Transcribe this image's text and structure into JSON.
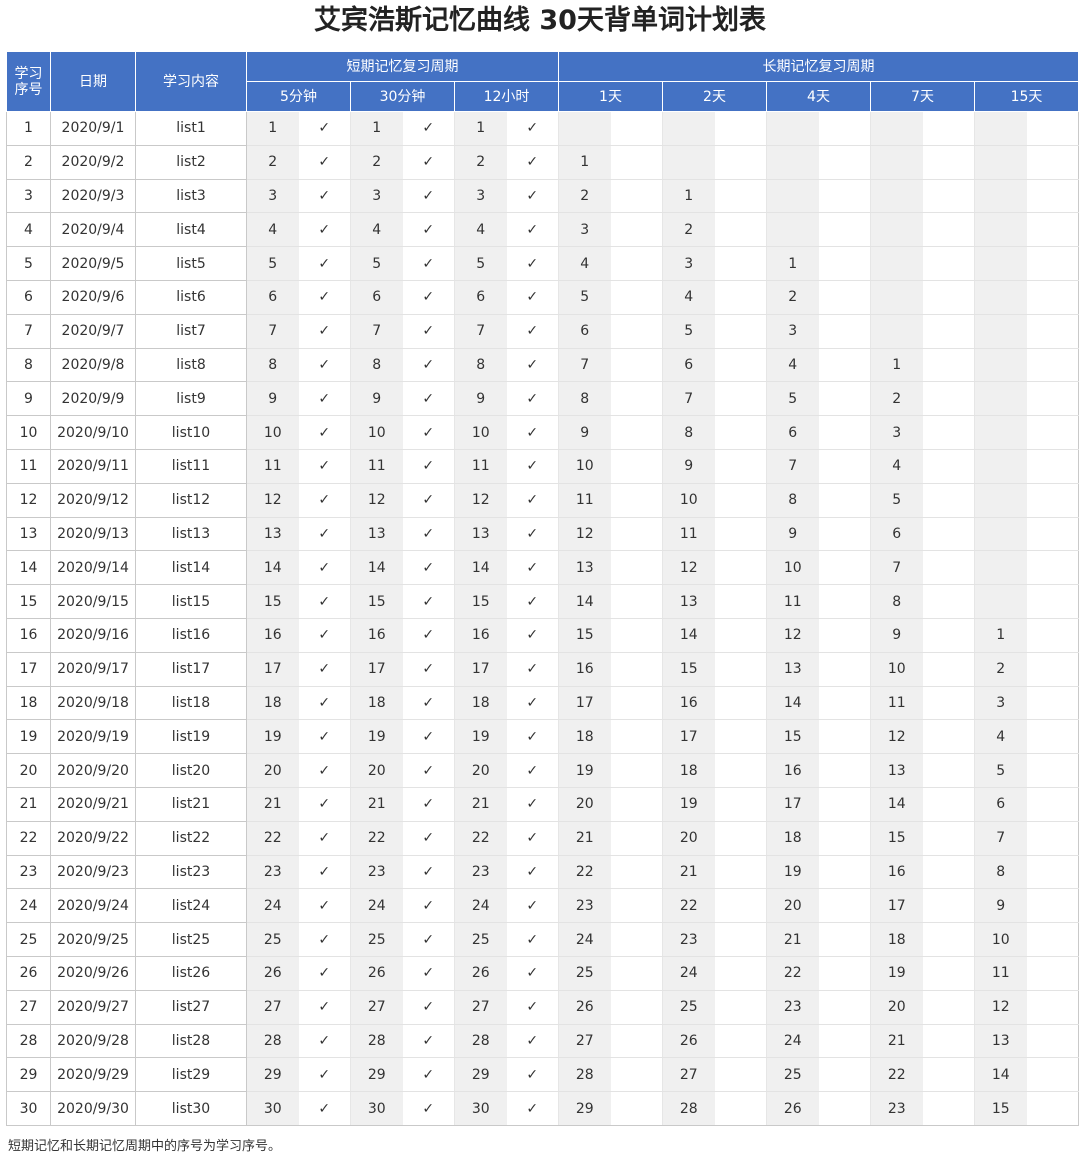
{
  "title": "艾宾浩斯记忆曲线 30天背单词计划表",
  "header": {
    "seq": "学习\n序号",
    "date": "日期",
    "content": "学习内容",
    "short_group": "短期记忆复习周期",
    "long_group": "长期记忆复习周期",
    "short_periods": [
      "5分钟",
      "30分钟",
      "12小时"
    ],
    "long_periods": [
      "1天",
      "2天",
      "4天",
      "7天",
      "15天"
    ]
  },
  "check_mark": "✓",
  "colors": {
    "header_bg": "#4472c4",
    "shaded_cell": "#f0f0f0"
  },
  "rows": [
    {
      "seq": "1",
      "date": "2020/9/1",
      "content": "list1",
      "long": [
        "",
        "",
        "",
        "",
        ""
      ]
    },
    {
      "seq": "2",
      "date": "2020/9/2",
      "content": "list2",
      "long": [
        "1",
        "",
        "",
        "",
        ""
      ]
    },
    {
      "seq": "3",
      "date": "2020/9/3",
      "content": "list3",
      "long": [
        "2",
        "1",
        "",
        "",
        ""
      ]
    },
    {
      "seq": "4",
      "date": "2020/9/4",
      "content": "list4",
      "long": [
        "3",
        "2",
        "",
        "",
        ""
      ]
    },
    {
      "seq": "5",
      "date": "2020/9/5",
      "content": "list5",
      "long": [
        "4",
        "3",
        "1",
        "",
        ""
      ]
    },
    {
      "seq": "6",
      "date": "2020/9/6",
      "content": "list6",
      "long": [
        "5",
        "4",
        "2",
        "",
        ""
      ]
    },
    {
      "seq": "7",
      "date": "2020/9/7",
      "content": "list7",
      "long": [
        "6",
        "5",
        "3",
        "",
        ""
      ]
    },
    {
      "seq": "8",
      "date": "2020/9/8",
      "content": "list8",
      "long": [
        "7",
        "6",
        "4",
        "1",
        ""
      ]
    },
    {
      "seq": "9",
      "date": "2020/9/9",
      "content": "list9",
      "long": [
        "8",
        "7",
        "5",
        "2",
        ""
      ]
    },
    {
      "seq": "10",
      "date": "2020/9/10",
      "content": "list10",
      "long": [
        "9",
        "8",
        "6",
        "3",
        ""
      ]
    },
    {
      "seq": "11",
      "date": "2020/9/11",
      "content": "list11",
      "long": [
        "10",
        "9",
        "7",
        "4",
        ""
      ]
    },
    {
      "seq": "12",
      "date": "2020/9/12",
      "content": "list12",
      "long": [
        "11",
        "10",
        "8",
        "5",
        ""
      ]
    },
    {
      "seq": "13",
      "date": "2020/9/13",
      "content": "list13",
      "long": [
        "12",
        "11",
        "9",
        "6",
        ""
      ]
    },
    {
      "seq": "14",
      "date": "2020/9/14",
      "content": "list14",
      "long": [
        "13",
        "12",
        "10",
        "7",
        ""
      ]
    },
    {
      "seq": "15",
      "date": "2020/9/15",
      "content": "list15",
      "long": [
        "14",
        "13",
        "11",
        "8",
        ""
      ]
    },
    {
      "seq": "16",
      "date": "2020/9/16",
      "content": "list16",
      "long": [
        "15",
        "14",
        "12",
        "9",
        "1"
      ]
    },
    {
      "seq": "17",
      "date": "2020/9/17",
      "content": "list17",
      "long": [
        "16",
        "15",
        "13",
        "10",
        "2"
      ]
    },
    {
      "seq": "18",
      "date": "2020/9/18",
      "content": "list18",
      "long": [
        "17",
        "16",
        "14",
        "11",
        "3"
      ]
    },
    {
      "seq": "19",
      "date": "2020/9/19",
      "content": "list19",
      "long": [
        "18",
        "17",
        "15",
        "12",
        "4"
      ]
    },
    {
      "seq": "20",
      "date": "2020/9/20",
      "content": "list20",
      "long": [
        "19",
        "18",
        "16",
        "13",
        "5"
      ]
    },
    {
      "seq": "21",
      "date": "2020/9/21",
      "content": "list21",
      "long": [
        "20",
        "19",
        "17",
        "14",
        "6"
      ]
    },
    {
      "seq": "22",
      "date": "2020/9/22",
      "content": "list22",
      "long": [
        "21",
        "20",
        "18",
        "15",
        "7"
      ]
    },
    {
      "seq": "23",
      "date": "2020/9/23",
      "content": "list23",
      "long": [
        "22",
        "21",
        "19",
        "16",
        "8"
      ]
    },
    {
      "seq": "24",
      "date": "2020/9/24",
      "content": "list24",
      "long": [
        "23",
        "22",
        "20",
        "17",
        "9"
      ]
    },
    {
      "seq": "25",
      "date": "2020/9/25",
      "content": "list25",
      "long": [
        "24",
        "23",
        "21",
        "18",
        "10"
      ]
    },
    {
      "seq": "26",
      "date": "2020/9/26",
      "content": "list26",
      "long": [
        "25",
        "24",
        "22",
        "19",
        "11"
      ]
    },
    {
      "seq": "27",
      "date": "2020/9/27",
      "content": "list27",
      "long": [
        "26",
        "25",
        "23",
        "20",
        "12"
      ]
    },
    {
      "seq": "28",
      "date": "2020/9/28",
      "content": "list28",
      "long": [
        "27",
        "26",
        "24",
        "21",
        "13"
      ]
    },
    {
      "seq": "29",
      "date": "2020/9/29",
      "content": "list29",
      "long": [
        "28",
        "27",
        "25",
        "22",
        "14"
      ]
    },
    {
      "seq": "30",
      "date": "2020/9/30",
      "content": "list30",
      "long": [
        "29",
        "28",
        "26",
        "23",
        "15"
      ]
    }
  ],
  "note": "短期记忆和长期记忆周期中的序号为学习序号。"
}
